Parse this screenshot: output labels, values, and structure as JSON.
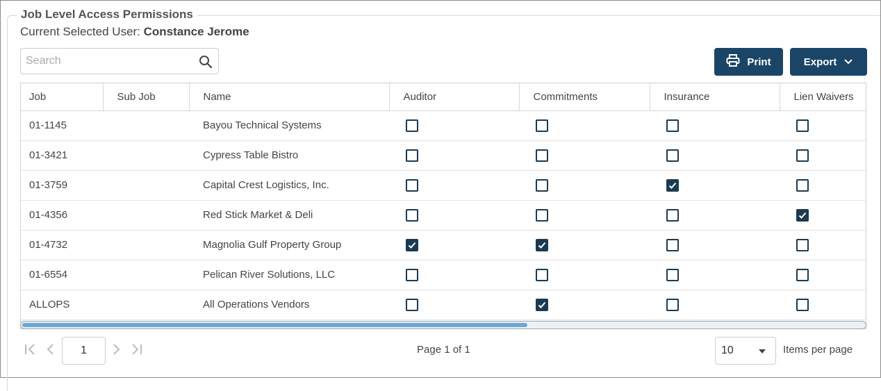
{
  "panel": {
    "title": "Job Level Access Permissions",
    "current_user_label": "Current Selected User:",
    "current_user_name": "Constance Jerome"
  },
  "search": {
    "placeholder": "Search",
    "icon": "search-icon"
  },
  "toolbar": {
    "print_label": "Print",
    "print_icon": "printer-icon",
    "export_label": "Export",
    "export_icon": "chevron-down-icon",
    "accent_color": "#1b4566"
  },
  "table": {
    "columns": [
      "Job",
      "Sub Job",
      "Name",
      "Auditor",
      "Commitments",
      "Insurance",
      "Lien Waivers"
    ],
    "rows": [
      {
        "job": "01-1145",
        "sub_job": "",
        "name": "Bayou Technical Systems",
        "auditor": false,
        "commitments": false,
        "insurance": false,
        "lien_waivers": false
      },
      {
        "job": "01-3421",
        "sub_job": "",
        "name": "Cypress Table Bistro",
        "auditor": false,
        "commitments": false,
        "insurance": false,
        "lien_waivers": false
      },
      {
        "job": "01-3759",
        "sub_job": "",
        "name": "Capital Crest Logistics, Inc.",
        "auditor": false,
        "commitments": false,
        "insurance": true,
        "lien_waivers": false
      },
      {
        "job": "01-4356",
        "sub_job": "",
        "name": "Red Stick Market & Deli",
        "auditor": false,
        "commitments": false,
        "insurance": false,
        "lien_waivers": true
      },
      {
        "job": "01-4732",
        "sub_job": "",
        "name": "Magnolia Gulf Property Group",
        "auditor": true,
        "commitments": true,
        "insurance": false,
        "lien_waivers": false
      },
      {
        "job": "01-6554",
        "sub_job": "",
        "name": "Pelican River Solutions, LLC",
        "auditor": false,
        "commitments": false,
        "insurance": false,
        "lien_waivers": false
      },
      {
        "job": "ALLOPS",
        "sub_job": "",
        "name": "All Operations Vendors",
        "auditor": false,
        "commitments": true,
        "insurance": false,
        "lien_waivers": false
      }
    ],
    "checkbox_color": "#1b3a52",
    "horizontal_scroll_fraction": 0.6
  },
  "pager": {
    "current_page": "1",
    "page_info": "Page 1 of 1",
    "items_per_page": "10",
    "items_per_page_label": "Items per page"
  }
}
